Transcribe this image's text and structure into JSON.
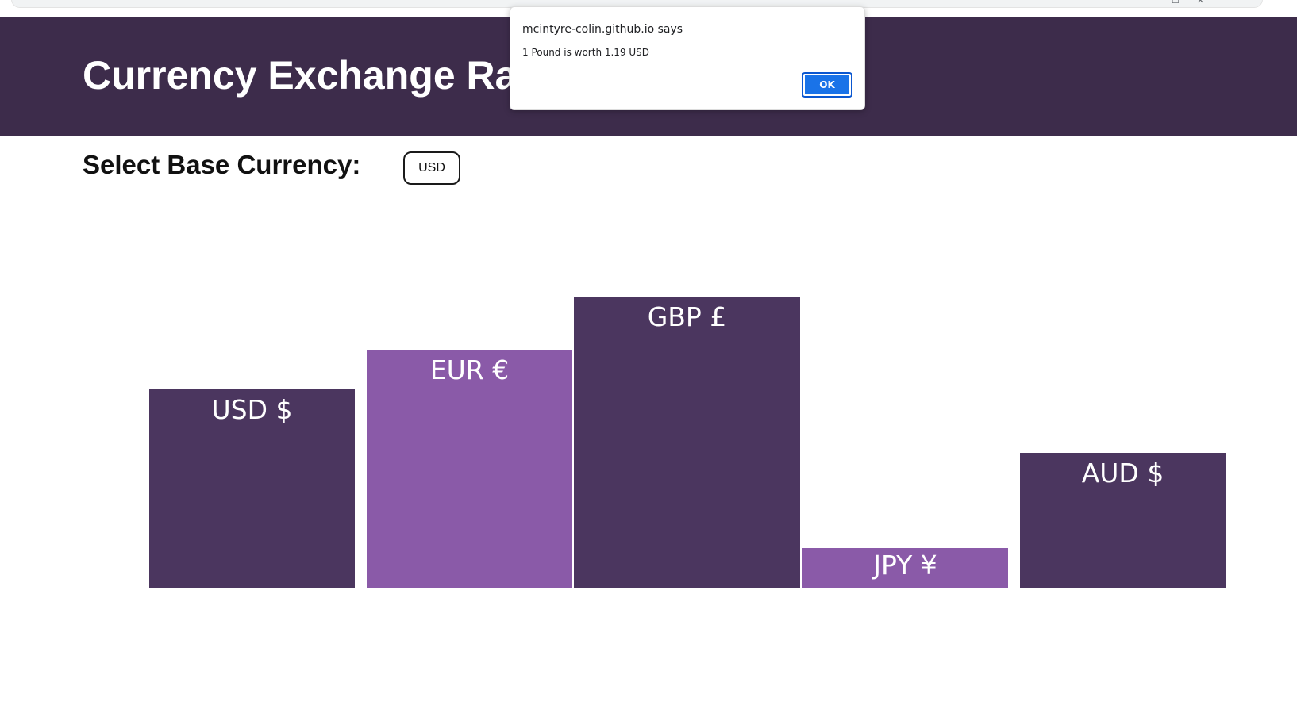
{
  "page": {
    "title": "Currency Exchange Ra",
    "base_label": "Select Base Currency:",
    "base_selected": "USD"
  },
  "colors": {
    "header_bg": "#3d2c4b",
    "bar_dark": "#4b365f",
    "bar_light": "#8a5aa8",
    "ok_button": "#1a73e8"
  },
  "chart_data": {
    "type": "bar",
    "categories": [
      "USD $",
      "EUR €",
      "GBP £",
      "JPY ¥",
      "AUD $"
    ],
    "values": [
      1.0,
      1.2,
      1.47,
      0.2,
      0.68
    ],
    "title": "",
    "xlabel": "",
    "ylabel": "",
    "grid": false
  },
  "dialog": {
    "origin": "mcintyre-colin.github.io says",
    "message": "1 Pound is worth 1.19 USD",
    "ok_label": "OK"
  }
}
